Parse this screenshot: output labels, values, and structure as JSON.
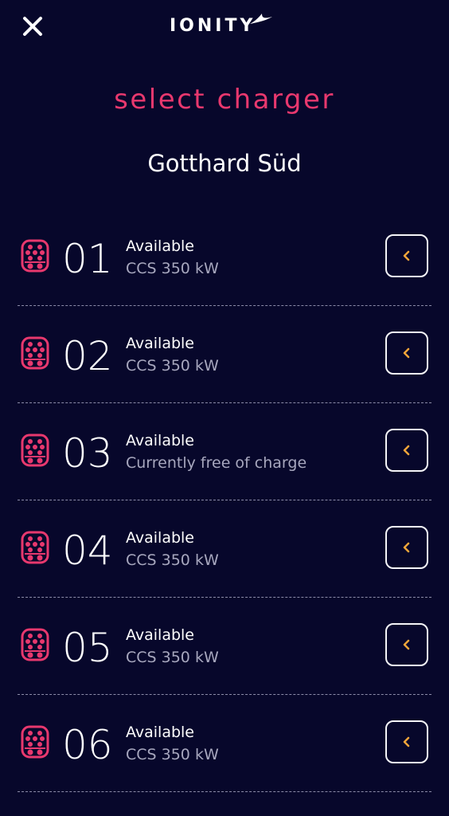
{
  "header": {
    "brand": "IONITY",
    "close_icon": "close-icon"
  },
  "title": "select charger",
  "station_name": "Gotthard Süd",
  "colors": {
    "background": "#07072b",
    "accent_pink": "#e8386e",
    "chevron_orange": "#f0a53a",
    "subtext": "#a7a7be"
  },
  "chargers": [
    {
      "number": "01",
      "status": "Available",
      "detail": "CCS 350 kW"
    },
    {
      "number": "02",
      "status": "Available",
      "detail": "CCS 350 kW"
    },
    {
      "number": "03",
      "status": "Available",
      "detail": "Currently free of charge"
    },
    {
      "number": "04",
      "status": "Available",
      "detail": "CCS 350 kW"
    },
    {
      "number": "05",
      "status": "Available",
      "detail": "CCS 350 kW"
    },
    {
      "number": "06",
      "status": "Available",
      "detail": "CCS 350 kW"
    }
  ]
}
